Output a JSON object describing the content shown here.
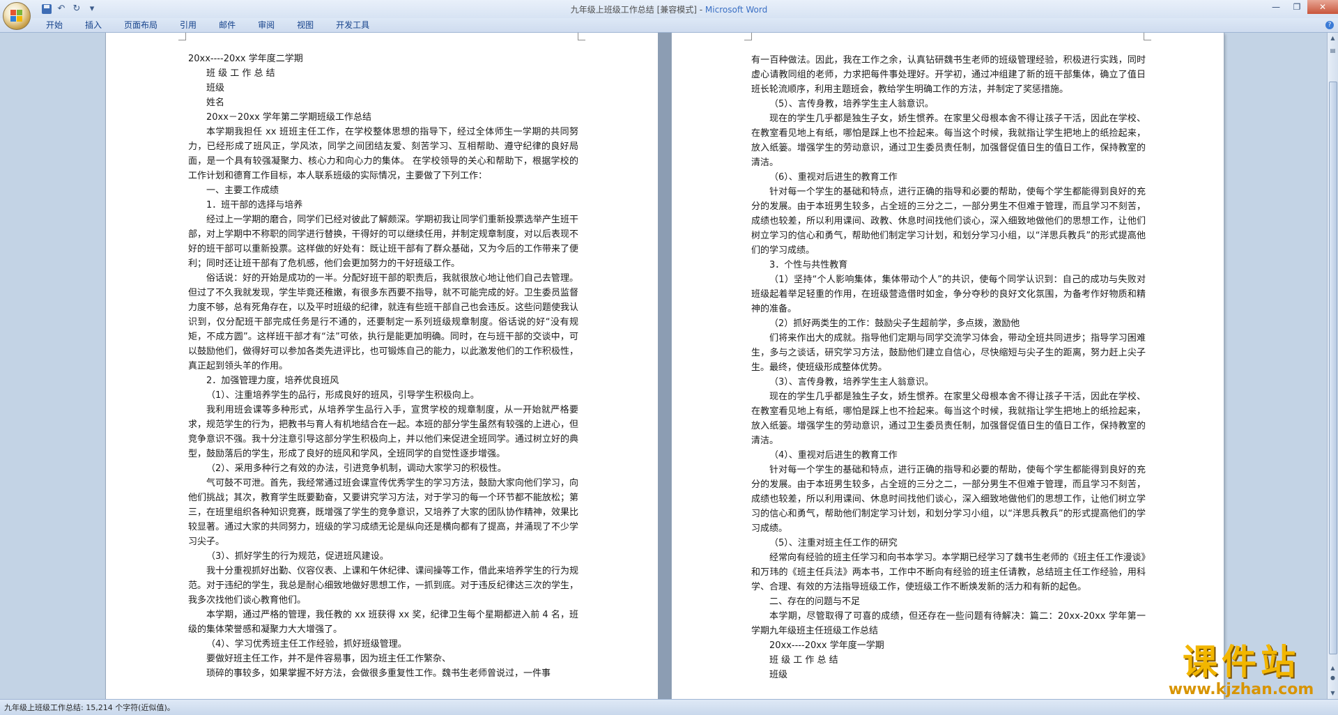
{
  "window": {
    "title": "九年级上班级工作总结 [兼容模式] - ",
    "app_name": "Microsoft Word"
  },
  "quick_access": {
    "more": "▾"
  },
  "ribbon": {
    "tabs": [
      "开始",
      "插入",
      "页面布局",
      "引用",
      "邮件",
      "审阅",
      "视图",
      "开发工具"
    ]
  },
  "left_page": {
    "paragraphs": [
      {
        "cls": "",
        "text": "20xx----20xx 学年度二学期"
      },
      {
        "cls": "ind",
        "text": "班 级 工 作 总 结"
      },
      {
        "cls": "ind",
        "text": "班级"
      },
      {
        "cls": "ind",
        "text": "姓名"
      },
      {
        "cls": "ind",
        "text": "20xx－20xx 学年第二学期班级工作总结"
      },
      {
        "cls": "ind",
        "text": "本学期我担任 xx 班班主任工作，在学校整体思想的指导下，经过全体师生一学期的共同努力，已经形成了班风正，学风浓，同学之间团结友爱、刻苦学习、互相帮助、遵守纪律的良好局面，是一个具有较强凝聚力、核心力和向心力的集体。 在学校领导的关心和帮助下，根据学校的工作计划和德育工作目标，本人联系班级的实际情况，主要做了下列工作："
      },
      {
        "cls": "ind",
        "text": "一、主要工作成绩"
      },
      {
        "cls": "ind",
        "text": "1．班干部的选择与培养"
      },
      {
        "cls": "ind",
        "text": "经过上一学期的磨合，同学们已经对彼此了解颇深。学期初我让同学们重新投票选举产生班干部，对上学期中不称职的同学进行替换，干得好的可以继续任用，并制定规章制度，对以后表现不好的班干部可以重新投票。这样做的好处有：既让班干部有了群众基础，又为今后的工作带来了便利；同时还让班干部有了危机感，他们会更加努力的干好班级工作。"
      },
      {
        "cls": "ind",
        "text": "俗话说：好的开始是成功的一半。分配好班干部的职责后，我就很放心地让他们自己去管理。但过了不久我就发现，学生毕竟还稚嫩，有很多东西要不指导，就不可能完成的好。卫生委员监督力度不够，总有死角存在，以及平时班级的纪律，就连有些班干部自己也会违反。这些问题使我认识到，仅分配班干部完成任务是行不通的，还要制定一系列班级规章制度。俗话说的好“没有规矩，不成方圆”。这样班干部才有“法”可依，执行是能更加明确。同时，在与班干部的交谈中，可以鼓励他们，做得好可以参加各类先进评比，也可锻炼自己的能力，以此激发他们的工作积极性，真正起到领头羊的作用。"
      },
      {
        "cls": "ind",
        "text": "2．加强管理力度，培养优良班风"
      },
      {
        "cls": "ind",
        "text": "（1）、注重培养学生的品行，形成良好的班风，引导学生积极向上。"
      },
      {
        "cls": "ind",
        "text": "我利用班会课等多种形式，从培养学生品行入手，宣贯学校的规章制度，从一开始就严格要求，规范学生的行为，把教书与育人有机地结合在一起。本班的部分学生虽然有较强的上进心，但竞争意识不强。我十分注意引导这部分学生积极向上，并以他们来促进全班同学。通过树立好的典型，鼓励落后的学生，形成了良好的班风和学风，全班同学的自觉性逐步增强。"
      },
      {
        "cls": "ind",
        "text": "（2）、采用多种行之有效的办法，引进竞争机制，调动大家学习的积极性。"
      },
      {
        "cls": "ind",
        "text": "气可鼓不可泄。首先，我经常通过班会课宣传优秀学生的学习方法，鼓励大家向他们学习，向他们挑战；其次，教育学生既要勤奋，又要讲究学习方法，对于学习的每一个环节都不能放松；第三，在班里组织各种知识竞赛，既增强了学生的竞争意识，又培养了大家的团队协作精神，效果比较显著。通过大家的共同努力，班级的学习成绩无论是纵向还是横向都有了提高，并涌现了不少学习尖子。"
      },
      {
        "cls": "ind",
        "text": "（3）、抓好学生的行为规范，促进班风建设。"
      },
      {
        "cls": "ind",
        "text": "我十分重视抓好出勤、仪容仪表、上课和午休纪律、课间操等工作，借此来培养学生的行为规范。对于违纪的学生，我总是耐心细致地做好思想工作，一抓到底。对于违反纪律达三次的学生，我多次找他们谈心教育他们。"
      },
      {
        "cls": "ind",
        "text": "本学期，通过严格的管理，我任教的 xx 班获得 xx 奖，纪律卫生每个星期都进入前 4 名，班级的集体荣誉感和凝聚力大大增强了。"
      },
      {
        "cls": "ind",
        "text": "（4）、学习优秀班主任工作经验，抓好班级管理。"
      },
      {
        "cls": "ind",
        "text": "要做好班主任工作，并不是件容易事，因为班主任工作繁杂、"
      },
      {
        "cls": "ind",
        "text": "琐碎的事较多，如果掌握不好方法，会做很多重复性工作。魏书生老师曾说过，一件事"
      }
    ]
  },
  "right_page": {
    "paragraphs": [
      {
        "cls": "",
        "text": "有一百种做法。因此，我在工作之余，认真钻研魏书生老师的班级管理经验，积极进行实践，同时虚心请教同组的老师，力求把每件事处理好。开学初，通过冲组建了新的班干部集体，确立了值日班长轮流顺序，利用主题班会，教给学生明确工作的方法，并制定了奖惩措施。"
      },
      {
        "cls": "ind",
        "text": "（5）、言传身教，培养学生主人翁意识。"
      },
      {
        "cls": "ind",
        "text": "现在的学生几乎都是独生子女，娇生惯养。在家里父母根本舍不得让孩子干活，因此在学校、在教室看见地上有纸，哪怕是踩上也不捡起来。每当这个时候，我就指让学生把地上的纸捡起来，放入纸篓。增强学生的劳动意识，通过卫生委员责任制，加强督促值日生的值日工作，保持教室的清洁。"
      },
      {
        "cls": "ind",
        "text": "（6）、重视对后进生的教育工作"
      },
      {
        "cls": "ind",
        "text": "针对每一个学生的基础和特点，进行正确的指导和必要的帮助，使每个学生都能得到良好的充分的发展。由于本班男生较多，占全班的三分之二，一部分男生不但难于管理，而且学习不刻苦，成绩也较差，所以利用课间、政教、休息时间找他们谈心，深入细致地做他们的思想工作，让他们树立学习的信心和勇气，帮助他们制定学习计划，和划分学习小组，以“洋思兵教兵”的形式提高他们的学习成绩。"
      },
      {
        "cls": "ind",
        "text": "3．个性与共性教育"
      },
      {
        "cls": "ind",
        "text": "（1）坚持“个人影响集体，集体带动个人”的共识，使每个同学认识到：自己的成功与失败对班级起着举足轻重的作用，在班级营造借时如金，争分夺秒的良好文化氛围，为备考作好物质和精神的准备。"
      },
      {
        "cls": "ind",
        "text": "（2）抓好两类生的工作：鼓励尖子生超前学，多点拨，激励他"
      },
      {
        "cls": "ind",
        "text": "们将来作出大的成就。指导他们定期与同学交流学习体会，带动全班共同进步；指导学习困难生，多与之谈话，研究学习方法，鼓励他们建立自信心，尽快缩短与尖子生的距离，努力赶上尖子生。最终，使班级形成整体优势。"
      },
      {
        "cls": "ind",
        "text": "（3）、言传身教，培养学生主人翁意识。"
      },
      {
        "cls": "ind",
        "text": "现在的学生几乎都是独生子女，娇生惯养。在家里父母根本舍不得让孩子干活，因此在学校、在教室看见地上有纸，哪怕是踩上也不捡起来。每当这个时候，我就指让学生把地上的纸捡起来，放入纸篓。增强学生的劳动意识，通过卫生委员责任制，加强督促值日生的值日工作，保持教室的清洁。"
      },
      {
        "cls": "ind",
        "text": "（4）、重视对后进生的教育工作"
      },
      {
        "cls": "ind",
        "text": "针对每一个学生的基础和特点，进行正确的指导和必要的帮助，使每个学生都能得到良好的充分的发展。由于本班男生较多，占全班的三分之二，一部分男生不但难于管理，而且学习不刻苦，成绩也较差，所以利用课间、休息时间找他们谈心，深入细致地做他们的思想工作，让他们树立学习的信心和勇气，帮助他们制定学习计划，和划分学习小组，以“洋思兵教兵”的形式提高他们的学习成绩。"
      },
      {
        "cls": "ind",
        "text": "（5）、注重对班主任工作的研究"
      },
      {
        "cls": "ind",
        "text": "经常向有经验的班主任学习和向书本学习。本学期已经学习了魏书生老师的《班主任工作漫谈》和万玮的《班主任兵法》两本书，工作中不断向有经验的班主任请教，总结班主任工作经验，用科学、合理、有效的方法指导班级工作，使班级工作不断焕发新的活力和有新的起色。"
      },
      {
        "cls": "ind",
        "text": "二、存在的问题与不足"
      },
      {
        "cls": "ind",
        "text": "本学期，尽管取得了可喜的成绩，但还存在一些问题有待解决：篇二：20xx-20xx 学年第一学期九年级班主任班级工作总结"
      },
      {
        "cls": "ind",
        "text": "20xx----20xx 学年度一学期"
      },
      {
        "cls": "ind",
        "text": "班 级 工 作 总 结"
      },
      {
        "cls": "ind",
        "text": "班级"
      }
    ]
  },
  "status": {
    "text": "九年级上班级工作总结: 15,214 个字符(近似值)。"
  },
  "watermark": {
    "title": "课件站",
    "url": "www.kjzhan.com"
  }
}
